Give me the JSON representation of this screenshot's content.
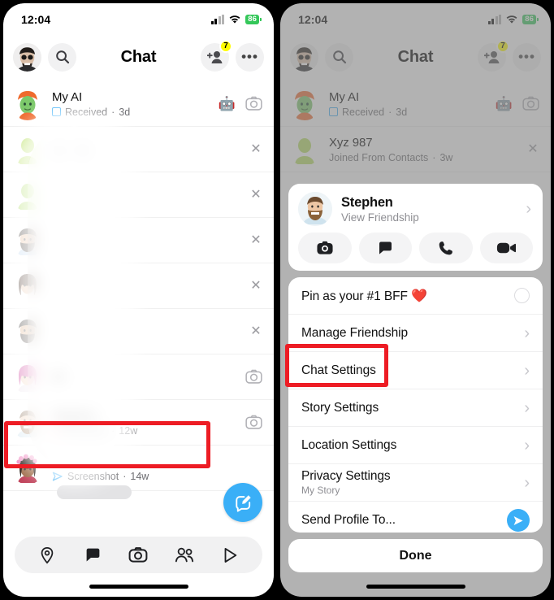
{
  "status_bar": {
    "time": "12:04",
    "battery": "86",
    "wifi_icon": "wifi-icon",
    "signal_icon": "cellular-signal-icon"
  },
  "left_panel": {
    "header": {
      "title": "Chat",
      "avatar_icon": "profile-bitmoji-avatar",
      "search_icon": "search-icon",
      "add_friend_icon": "add-friend-icon",
      "add_friend_badge": "7",
      "more_icon": "more-options-icon"
    },
    "rows": [
      {
        "name": "My AI",
        "status": "Received",
        "time": "3d",
        "status_icon": "chat-square-icon-blue",
        "trailing": "camera-icon",
        "extra": "robot-icon"
      },
      {
        "name": "",
        "status": "Joined From Conta",
        "status_tail": "cts",
        "time": "3w",
        "trailing": "close-icon"
      },
      {
        "name": "",
        "status": "",
        "time": "",
        "trailing": "close-icon"
      },
      {
        "name": "",
        "status": "",
        "time": "",
        "trailing": "close-icon"
      },
      {
        "name": "",
        "status": "",
        "time": "",
        "trailing": "close-icon"
      },
      {
        "name": "",
        "status": "",
        "time": "",
        "trailing": "close-icon"
      },
      {
        "name_tail": "tte",
        "status": "",
        "time": "",
        "trailing": "camera-icon"
      },
      {
        "name": "Stephen",
        "status": "Received",
        "time": "12w",
        "status_icon": "chat-square-icon-red",
        "trailing": "camera-icon",
        "highlighted": true
      },
      {
        "name": "",
        "status": "Screenshot",
        "time": "14w",
        "status_icon": "screenshot-icon",
        "trailing": "camera-icon"
      }
    ],
    "compose_icon": "compose-chat-icon",
    "bottom_nav": [
      {
        "icon": "map-location-icon",
        "label": "Map"
      },
      {
        "icon": "chat-bubble-icon",
        "label": "Chat"
      },
      {
        "icon": "camera-icon",
        "label": "Camera"
      },
      {
        "icon": "friends-icon",
        "label": "Stories"
      },
      {
        "icon": "spotlight-play-icon",
        "label": "Spotlight"
      }
    ]
  },
  "right_panel": {
    "header": {
      "title": "Chat",
      "avatar_icon": "profile-bitmoji-avatar",
      "search_icon": "search-icon",
      "add_friend_icon": "add-friend-icon",
      "add_friend_badge": "7",
      "more_icon": "more-options-icon"
    },
    "rows": [
      {
        "name": "My AI",
        "status": "Received",
        "time": "3d",
        "status_icon": "chat-square-icon-blue",
        "trailing": "camera-icon",
        "extra": "robot-icon"
      },
      {
        "name": "Xyz 987",
        "status": "Joined From Contacts",
        "time": "3w",
        "trailing": "close-icon"
      }
    ],
    "profile_card": {
      "name": "Stephen",
      "subtitle": "View Friendship",
      "chevron_icon": "chevron-right-icon",
      "actions": [
        {
          "icon": "camera-icon",
          "label": "Camera"
        },
        {
          "icon": "chat-bubble-icon",
          "label": "Chat"
        },
        {
          "icon": "phone-icon",
          "label": "Call"
        },
        {
          "icon": "video-camera-icon",
          "label": "Video Call"
        }
      ]
    },
    "menu": [
      {
        "label": "Pin as your #1 BFF",
        "emoji": "❤️",
        "control": "radio",
        "highlighted": false
      },
      {
        "label": "Manage Friendship",
        "control": "chevron",
        "highlighted": false
      },
      {
        "label": "Chat Settings",
        "control": "chevron",
        "highlighted": true
      },
      {
        "label": "Story Settings",
        "control": "chevron",
        "highlighted": false
      },
      {
        "label": "Location Settings",
        "control": "chevron",
        "highlighted": false
      },
      {
        "label": "Privacy Settings",
        "sublabel": "My Story",
        "control": "chevron",
        "highlighted": false
      },
      {
        "label": "Send Profile To...",
        "control": "send",
        "highlighted": false
      }
    ],
    "done_label": "Done"
  },
  "colors": {
    "accent_blue": "#3aaff7",
    "highlight_red": "#ed1c24",
    "badge_yellow": "#fffc00",
    "battery_green": "#34c759"
  }
}
